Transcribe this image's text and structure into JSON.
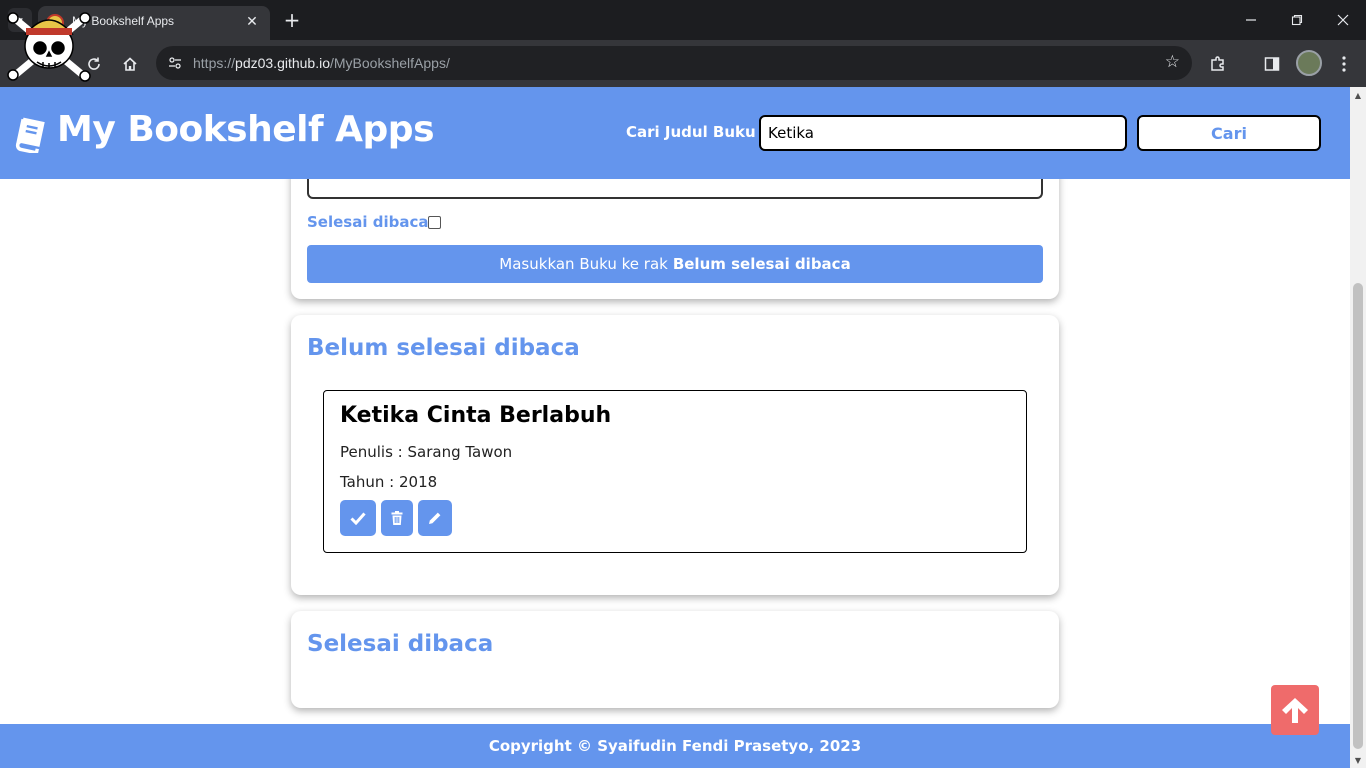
{
  "browser": {
    "tab_title": "My Bookshelf Apps",
    "tab_close": "✕",
    "new_tab": "+",
    "url_scheme": "https://",
    "url_host": "pdz03.github.io",
    "url_path": "/MyBookshelfApps/",
    "icons": [
      "tab-search-icon",
      "reload-icon",
      "home-icon",
      "site-info-icon",
      "bookmark-star-icon",
      "extensions-icon",
      "side-panel-icon",
      "profile-avatar",
      "menu-icon",
      "minimize-icon",
      "restore-icon",
      "close-icon"
    ]
  },
  "header": {
    "title": "My Bookshelf Apps",
    "search_label": "Cari Judul Buku",
    "search_value": "Ketika",
    "search_button": "Cari",
    "color": "#6495ed"
  },
  "form": {
    "checkbox_label": "Selesai dibaca",
    "checkbox_checked": false,
    "submit_prefix": "Masukkan Buku ke rak",
    "submit_bold": "Belum selesai dibaca"
  },
  "unread": {
    "title": "Belum selesai dibaca",
    "books": [
      {
        "title": "Ketika Cinta Berlabuh",
        "author": "Penulis : Sarang Tawon",
        "year": "Tahun : 2018",
        "actions": [
          "check-icon",
          "trash-icon",
          "pencil-icon"
        ]
      }
    ]
  },
  "read": {
    "title": "Selesai dibaca",
    "books": []
  },
  "footer": {
    "text": "Copyright © Syaifudin Fendi Prasetyo, 2023"
  },
  "back_to_top": {
    "icon": "arrow-up-icon",
    "color": "#ef6b6b"
  }
}
